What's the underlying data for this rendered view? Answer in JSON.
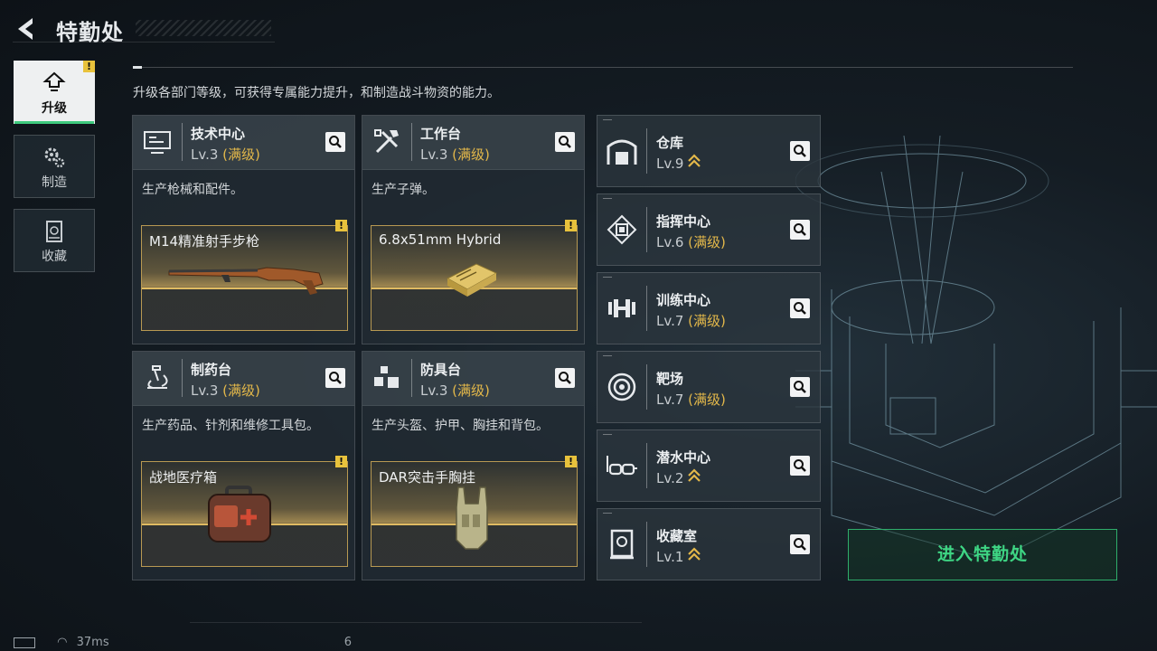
{
  "header": {
    "title": "特勤处"
  },
  "sidebar": {
    "items": [
      {
        "label": "升级",
        "icon": "upgrade-icon",
        "active": true,
        "alert": "!"
      },
      {
        "label": "制造",
        "icon": "gears-icon",
        "active": false
      },
      {
        "label": "收藏",
        "icon": "collection-icon",
        "active": false
      }
    ]
  },
  "description": "升级各部门等级，可获得专属能力提升，和制造战斗物资的能力。",
  "departments": [
    {
      "name": "技术中心",
      "level": "Lv.3",
      "maxed": "(满级)",
      "desc": "生产枪械和配件。",
      "item": "M14精准射手步枪",
      "icon": "tech-center-icon",
      "alert": "!"
    },
    {
      "name": "工作台",
      "level": "Lv.3",
      "maxed": "(满级)",
      "desc": "生产子弹。",
      "item": "6.8x51mm Hybrid",
      "icon": "workbench-icon",
      "alert": "!"
    },
    {
      "name": "制药台",
      "level": "Lv.3",
      "maxed": "(满级)",
      "desc": "生产药品、针剂和维修工具包。",
      "item": "战地医疗箱",
      "icon": "microscope-icon",
      "alert": "!"
    },
    {
      "name": "防具台",
      "level": "Lv.3",
      "maxed": "(满级)",
      "desc": "生产头盔、护甲、胸挂和背包。",
      "item": "DAR突击手胸挂",
      "icon": "armor-bench-icon",
      "alert": "!"
    }
  ],
  "facilities": [
    {
      "name": "仓库",
      "level": "Lv.9",
      "maxed": "",
      "upgradable": true,
      "icon": "warehouse-icon"
    },
    {
      "name": "指挥中心",
      "level": "Lv.6",
      "maxed": "(满级)",
      "upgradable": false,
      "icon": "chip-icon"
    },
    {
      "name": "训练中心",
      "level": "Lv.7",
      "maxed": "(满级)",
      "upgradable": false,
      "icon": "dumbbell-icon"
    },
    {
      "name": "靶场",
      "level": "Lv.7",
      "maxed": "(满级)",
      "upgradable": false,
      "icon": "target-icon"
    },
    {
      "name": "潜水中心",
      "level": "Lv.2",
      "maxed": "",
      "upgradable": true,
      "icon": "dive-mask-icon"
    },
    {
      "name": "收藏室",
      "level": "Lv.1",
      "maxed": "",
      "upgradable": true,
      "icon": "collection-room-icon"
    }
  ],
  "enter_button": "进入特勤处",
  "status": {
    "ping": "37ms",
    "count": "6"
  },
  "colors": {
    "accent_green": "#3ed684",
    "gold": "#e3b84a",
    "panel": "#2c363e"
  }
}
